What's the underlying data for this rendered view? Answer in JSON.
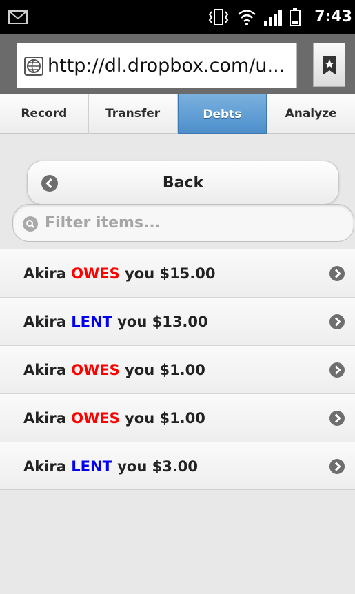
{
  "status_bar": {
    "time": "7:43 PM",
    "icons": [
      "gmail-icon",
      "vibrate-icon",
      "wifi-icon",
      "signal-icon",
      "battery-icon"
    ]
  },
  "browser": {
    "url": "http://dl.dropbox.com/u...",
    "bookmark_icon": "bookmark-star-icon"
  },
  "tabs": [
    {
      "label": "Record",
      "active": false
    },
    {
      "label": "Transfer",
      "active": false
    },
    {
      "label": "Debts",
      "active": true
    },
    {
      "label": "Analyze",
      "active": false
    }
  ],
  "back_button": {
    "label": "Back"
  },
  "filter": {
    "placeholder": "Filter items...",
    "value": ""
  },
  "debts": [
    {
      "name": "Akira",
      "type": "OWES",
      "suffix": "you $15.00"
    },
    {
      "name": "Akira",
      "type": "LENT",
      "suffix": "you $13.00"
    },
    {
      "name": "Akira",
      "type": "OWES",
      "suffix": "you $1.00"
    },
    {
      "name": "Akira",
      "type": "OWES",
      "suffix": "you $1.00"
    },
    {
      "name": "Akira",
      "type": "LENT",
      "suffix": "you $3.00"
    }
  ],
  "colors": {
    "owes": "#ff0000",
    "lent": "#0000ee",
    "active_tab": "#5e9ed6",
    "status_bar": "#000000",
    "url_bar": "#6b6b6b"
  }
}
